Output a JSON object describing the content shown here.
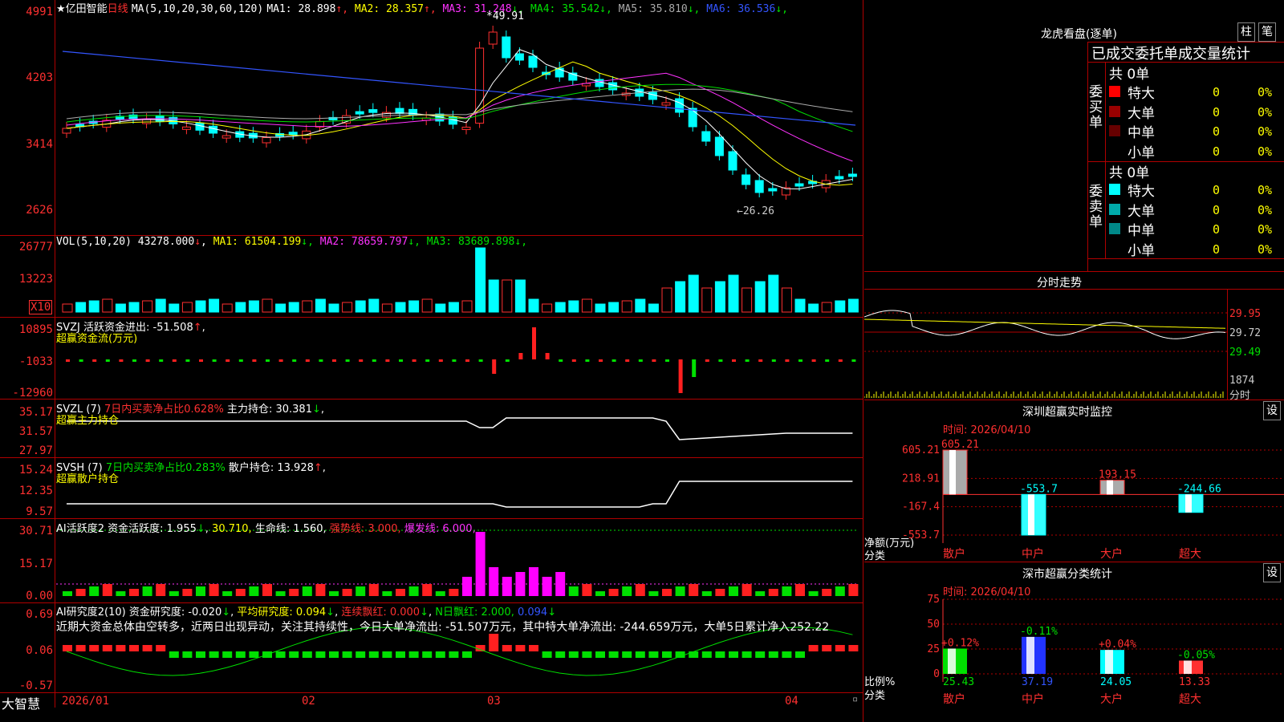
{
  "main": {
    "title": "★亿田智能",
    "period": "日线",
    "ma_label": "MA(5,10,20,30,60,120)",
    "ma": [
      {
        "name": "MA1:",
        "value": "28.898",
        "arrow": "↑",
        "color": "#ffffff"
      },
      {
        "name": "MA2:",
        "value": "28.357",
        "arrow": "↑",
        "color": "#ffff00"
      },
      {
        "name": "MA3:",
        "value": "31.248",
        "arrow": "↓",
        "color": "#ff33ff"
      },
      {
        "name": "MA4:",
        "value": "35.542",
        "arrow": "↓",
        "color": "#00e000"
      },
      {
        "name": "MA5:",
        "value": "35.810",
        "arrow": "↓",
        "color": "#aaaaaa"
      },
      {
        "name": "MA6:",
        "value": "36.536",
        "arrow": "↓",
        "color": "#3355ff"
      }
    ],
    "y_ticks": [
      "4991",
      "4203",
      "3414",
      "2626"
    ],
    "high_mark": "49.91",
    "low_mark": "←26.26"
  },
  "vol": {
    "label": "VOL(5,10,20)",
    "value": "43278.000",
    "arrow": "↓",
    "ma": [
      {
        "name": "MA1:",
        "value": "61504.199",
        "arrow": "↓",
        "color": "#ffff00"
      },
      {
        "name": "MA2:",
        "value": "78659.797",
        "arrow": "↓",
        "color": "#ff33ff"
      },
      {
        "name": "MA3:",
        "value": "83689.898",
        "arrow": "↓",
        "color": "#00e000"
      }
    ],
    "y_ticks": [
      "26777",
      "13223"
    ],
    "unit": "X10"
  },
  "svzj": {
    "label": "SVZJ",
    "text": "活跃资金进出: -51.508",
    "arrow": "↑",
    "sub": "超赢资金流(万元)",
    "y_ticks": [
      "10895",
      "-1033",
      "-12960"
    ]
  },
  "svzl": {
    "label": "SVZL (7)",
    "ratio": "7日内买卖净占比0.628%",
    "main": "主力持仓: 30.381",
    "arrow": "↓",
    "sub": "超赢主力持仓",
    "y_ticks": [
      "35.17",
      "31.57",
      "27.97"
    ]
  },
  "svsh": {
    "label": "SVSH (7)",
    "ratio": "7日内买卖净占比0.283%",
    "main": "散户持仓: 13.928",
    "arrow": "↑",
    "sub": "超赢散户持仓",
    "y_ticks": [
      "15.24",
      "12.35",
      "9.57"
    ]
  },
  "ai1": {
    "label": "AI活跃度2",
    "a": "资金活跃度: 1.955",
    "b": "30.710,",
    "c": "生命线: 1.560,",
    "d": "强势线: 3.000,",
    "e": "爆发线: 6.000,",
    "y_ticks": [
      "30.71",
      "15.17",
      "0.00"
    ]
  },
  "ai2": {
    "label": "AI研究度2(10)",
    "a": "资金研究度: -0.020",
    "b": "平均研究度: 0.094",
    "c": "连续飘红: 0.000",
    "d": "N日飘红: 2.000,",
    "e": "0.094",
    "commentary": "近期大资金总体由空转多，近两日出现异动，关注其持续性，今日大单净流出: -51.507万元，其中特大单净流出: -244.659万元，大单5日累计净入252.22",
    "y_ticks": [
      "0.69",
      "0.06",
      "-0.57"
    ]
  },
  "xaxis": {
    "brand": "大智慧",
    "dates": [
      "2026/01",
      "02",
      "03",
      "04"
    ]
  },
  "right": {
    "lhb_title": "龙虎看盘(逐单)",
    "btn_zhu": "柱",
    "btn_bi": "笔",
    "stats_header": "已成交委托单成交量统计",
    "buy_side": "委买单",
    "sell_side": "委卖单",
    "buy_total": "共 0单",
    "sell_total": "共 0单",
    "buy_rows": [
      {
        "name": "特大",
        "count": "0",
        "pct": "0%",
        "color": "#ff0000"
      },
      {
        "name": "大单",
        "count": "0",
        "pct": "0%",
        "color": "#990000"
      },
      {
        "name": "中单",
        "count": "0",
        "pct": "0%",
        "color": "#660000"
      },
      {
        "name": "小单",
        "count": "0",
        "pct": "0%",
        "color": ""
      }
    ],
    "sell_rows": [
      {
        "name": "特大",
        "count": "0",
        "pct": "0%",
        "color": "#00ffff"
      },
      {
        "name": "大单",
        "count": "0",
        "pct": "0%",
        "color": "#00aaaa"
      },
      {
        "name": "中单",
        "count": "0",
        "pct": "0%",
        "color": "#008888"
      },
      {
        "name": "小单",
        "count": "0",
        "pct": "0%",
        "color": ""
      }
    ],
    "intraday_title": "分时走势",
    "intraday_prices": [
      "29.95",
      "29.72",
      "29.49"
    ],
    "intraday_vol": "1874",
    "intraday_vol_unit": "分时"
  },
  "monitor": {
    "title": "深圳超赢实时监控",
    "btn": "设",
    "time": "时间: 2026/04/10",
    "y_ticks": [
      "605.21",
      "218.91",
      "-167.4",
      "-553.7"
    ],
    "unit_label": "净额(万元)",
    "cat_label": "分类",
    "categories": [
      "散户",
      "中户",
      "大户",
      "超大"
    ],
    "values": [
      605.21,
      -553.7,
      193.15,
      -244.66
    ],
    "value_labels": [
      "605.21",
      "-553.7",
      "193.15",
      "-244.66"
    ]
  },
  "classify": {
    "title": "深市超赢分类统计",
    "btn": "设",
    "time": "时间: 2026/04/10",
    "y_ticks": [
      "75",
      "50",
      "25",
      "0"
    ],
    "unit_label": "比例%",
    "cat_label": "分类",
    "categories": [
      "散户",
      "中户",
      "大户",
      "超大"
    ],
    "values": [
      25.43,
      37.19,
      24.05,
      13.33
    ],
    "value_labels": [
      "25.43",
      "37.19",
      "24.05",
      "13.33"
    ],
    "changes": [
      "+0.12%",
      "-0.11%",
      "+0.04%",
      "-0.05%"
    ]
  }
}
